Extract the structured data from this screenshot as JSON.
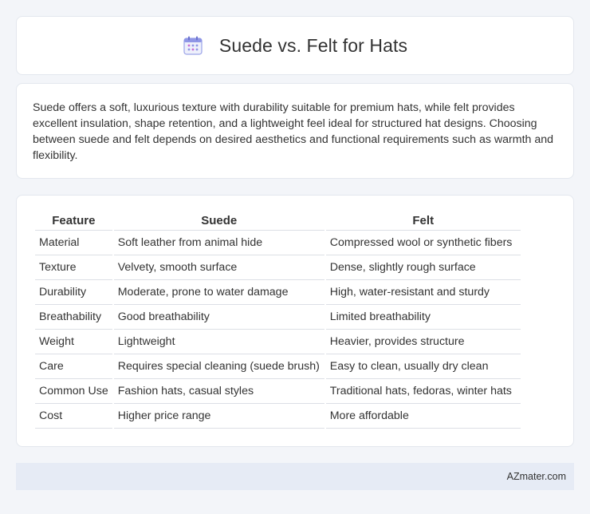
{
  "header": {
    "title": "Suede vs. Felt for Hats",
    "icon": "calendar-icon"
  },
  "summary": {
    "text": "Suede offers a soft, luxurious texture with durability suitable for premium hats, while felt provides excellent insulation, shape retention, and a lightweight feel ideal for structured hat designs. Choosing between suede and felt depends on desired aesthetics and functional requirements such as warmth and flexibility."
  },
  "table": {
    "headers": [
      "Feature",
      "Suede",
      "Felt"
    ],
    "rows": [
      [
        "Material",
        "Soft leather from animal hide",
        "Compressed wool or synthetic fibers"
      ],
      [
        "Texture",
        "Velvety, smooth surface",
        "Dense, slightly rough surface"
      ],
      [
        "Durability",
        "Moderate, prone to water damage",
        "High, water-resistant and sturdy"
      ],
      [
        "Breathability",
        "Good breathability",
        "Limited breathability"
      ],
      [
        "Weight",
        "Lightweight",
        "Heavier, provides structure"
      ],
      [
        "Care",
        "Requires special cleaning (suede brush)",
        "Easy to clean, usually dry clean"
      ],
      [
        "Common Use",
        "Fashion hats, casual styles",
        "Traditional hats, fedoras, winter hats"
      ],
      [
        "Cost",
        "Higher price range",
        "More affordable"
      ]
    ]
  },
  "footer": {
    "brand": "AZmater.com"
  },
  "colors": {
    "background": "#f3f5f9",
    "card": "#ffffff",
    "footer": "#e6ebf5",
    "icon_accent": "#7c6fe0"
  }
}
